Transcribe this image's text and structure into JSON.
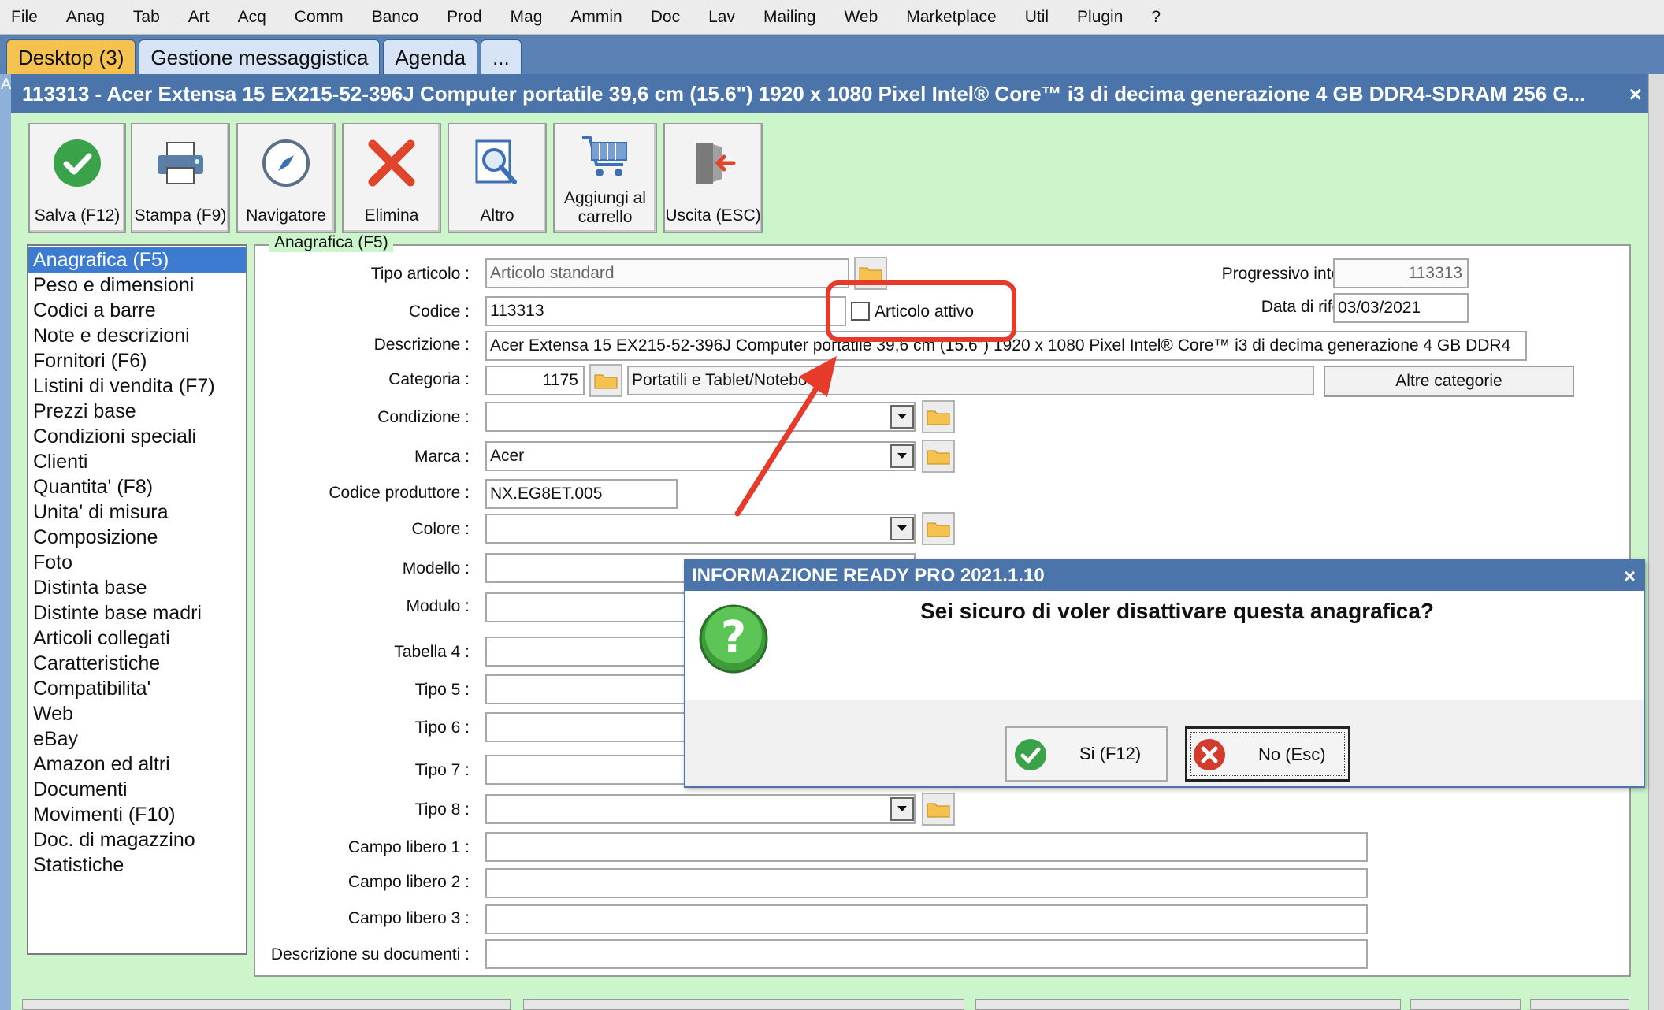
{
  "menu": [
    "File",
    "Anag",
    "Tab",
    "Art",
    "Acq",
    "Comm",
    "Banco",
    "Prod",
    "Mag",
    "Ammin",
    "Doc",
    "Lav",
    "Mailing",
    "Web",
    "Marketplace",
    "Util",
    "Plugin",
    "?"
  ],
  "tabs": [
    {
      "label": "Desktop (3)",
      "active": true
    },
    {
      "label": "Gestione messaggistica",
      "active": false
    },
    {
      "label": "Agenda",
      "active": false
    },
    {
      "label": "...",
      "active": false
    }
  ],
  "window": {
    "strip_letter": "A",
    "title": "113313 - Acer Extensa 15 EX215-52-396J Computer portatile 39,6 cm (15.6\") 1920 x 1080 Pixel Intel® Core™ i3 di decima generazione 4 GB DDR4-SDRAM 256 G...",
    "close": "×"
  },
  "toolbar": {
    "save": "Salva (F12)",
    "print": "Stampa (F9)",
    "navigator": "Navigatore",
    "delete": "Elimina",
    "other": "Altro",
    "cart_line1": "Aggiungi al",
    "cart_line2": "carrello",
    "exit": "Uscita (ESC)"
  },
  "nav": [
    "Anagrafica (F5)",
    "Peso e dimensioni",
    "Codici a barre",
    "Note e descrizioni",
    "Fornitori (F6)",
    "Listini di vendita (F7)",
    "Prezzi base",
    "Condizioni speciali",
    "Clienti",
    "Quantita' (F8)",
    "Unita' di misura",
    "Composizione",
    "Foto",
    "Distinta base",
    "Distinte base madri",
    "Articoli collegati",
    "Caratteristiche",
    "Compatibilita'",
    "Web",
    "eBay",
    "Amazon ed altri",
    "Documenti",
    "Movimenti (F10)",
    "Doc. di magazzino",
    "Statistiche"
  ],
  "form": {
    "group_title": "Anagrafica (F5)",
    "tipo_articolo_label": "Tipo articolo :",
    "tipo_articolo_value": "Articolo standard",
    "codice_label": "Codice :",
    "codice_value": "113313",
    "articolo_attivo_label": "Articolo attivo",
    "articolo_attivo_checked": false,
    "progressivo_label": "Progressivo interno (ID) :",
    "progressivo_value": "113313",
    "data_rif_label": "Data di riferimento :",
    "data_rif_value": "03/03/2021",
    "descrizione_label": "Descrizione :",
    "descrizione_value": "Acer Extensa 15 EX215-52-396J Computer portatile 39,6 cm (15.6\") 1920 x 1080 Pixel Intel® Core™ i3 di decima generazione 4 GB DDR4",
    "categoria_label": "Categoria :",
    "categoria_code": "1175",
    "categoria_name": "Portatili e Tablet/Notebook",
    "altre_categorie": "Altre categorie",
    "condizione_label": "Condizione :",
    "marca_label": "Marca :",
    "marca_value": "Acer",
    "codice_produttore_label": "Codice produttore :",
    "codice_produttore_value": "NX.EG8ET.005",
    "colore_label": "Colore :",
    "modello_label": "Modello :",
    "modulo_label": "Modulo :",
    "tabella4_label": "Tabella 4 :",
    "tipo5_label": "Tipo 5 :",
    "tipo6_label": "Tipo 6 :",
    "tipo7_label": "Tipo 7 :",
    "tipo8_label": "Tipo 8 :",
    "campo1_label": "Campo libero 1 :",
    "campo2_label": "Campo libero 2 :",
    "campo3_label": "Campo libero 3 :",
    "desc_doc_label": "Descrizione su documenti :"
  },
  "dialog": {
    "title": "INFORMAZIONE READY PRO 2021.1.10",
    "close": "×",
    "message": "Sei sicuro di voler disattivare questa anagrafica?",
    "yes": "Si (F12)",
    "no": "No (Esc)"
  },
  "colors": {
    "title_blue": "#4a74aa",
    "content_green": "#ccf5cc",
    "selection_blue": "#3d7bd1",
    "annotation_red": "#e63a2a",
    "active_tab": "#f6c24f"
  }
}
